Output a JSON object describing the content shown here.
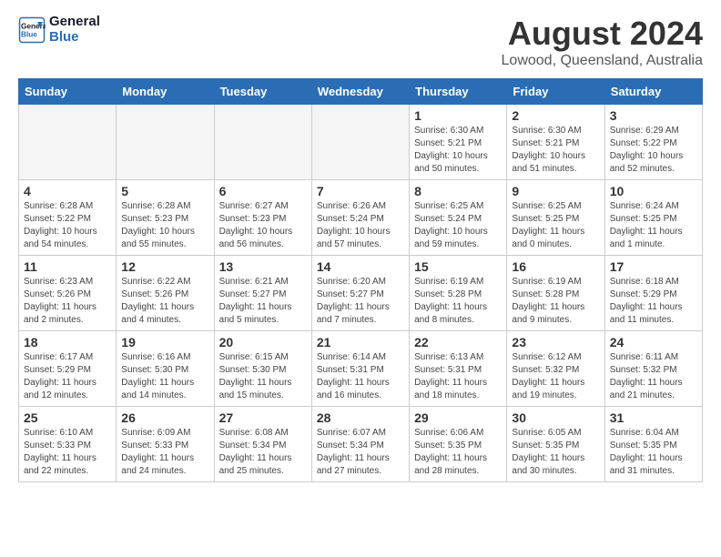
{
  "header": {
    "logo_line1": "General",
    "logo_line2": "Blue",
    "month_title": "August 2024",
    "location": "Lowood, Queensland, Australia"
  },
  "days_of_week": [
    "Sunday",
    "Monday",
    "Tuesday",
    "Wednesday",
    "Thursday",
    "Friday",
    "Saturday"
  ],
  "weeks": [
    [
      {
        "day": "",
        "info": "",
        "empty": true
      },
      {
        "day": "",
        "info": "",
        "empty": true
      },
      {
        "day": "",
        "info": "",
        "empty": true
      },
      {
        "day": "",
        "info": "",
        "empty": true
      },
      {
        "day": "1",
        "info": "Sunrise: 6:30 AM\nSunset: 5:21 PM\nDaylight: 10 hours\nand 50 minutes."
      },
      {
        "day": "2",
        "info": "Sunrise: 6:30 AM\nSunset: 5:21 PM\nDaylight: 10 hours\nand 51 minutes."
      },
      {
        "day": "3",
        "info": "Sunrise: 6:29 AM\nSunset: 5:22 PM\nDaylight: 10 hours\nand 52 minutes."
      }
    ],
    [
      {
        "day": "4",
        "info": "Sunrise: 6:28 AM\nSunset: 5:22 PM\nDaylight: 10 hours\nand 54 minutes."
      },
      {
        "day": "5",
        "info": "Sunrise: 6:28 AM\nSunset: 5:23 PM\nDaylight: 10 hours\nand 55 minutes."
      },
      {
        "day": "6",
        "info": "Sunrise: 6:27 AM\nSunset: 5:23 PM\nDaylight: 10 hours\nand 56 minutes."
      },
      {
        "day": "7",
        "info": "Sunrise: 6:26 AM\nSunset: 5:24 PM\nDaylight: 10 hours\nand 57 minutes."
      },
      {
        "day": "8",
        "info": "Sunrise: 6:25 AM\nSunset: 5:24 PM\nDaylight: 10 hours\nand 59 minutes."
      },
      {
        "day": "9",
        "info": "Sunrise: 6:25 AM\nSunset: 5:25 PM\nDaylight: 11 hours\nand 0 minutes."
      },
      {
        "day": "10",
        "info": "Sunrise: 6:24 AM\nSunset: 5:25 PM\nDaylight: 11 hours\nand 1 minute."
      }
    ],
    [
      {
        "day": "11",
        "info": "Sunrise: 6:23 AM\nSunset: 5:26 PM\nDaylight: 11 hours\nand 2 minutes."
      },
      {
        "day": "12",
        "info": "Sunrise: 6:22 AM\nSunset: 5:26 PM\nDaylight: 11 hours\nand 4 minutes."
      },
      {
        "day": "13",
        "info": "Sunrise: 6:21 AM\nSunset: 5:27 PM\nDaylight: 11 hours\nand 5 minutes."
      },
      {
        "day": "14",
        "info": "Sunrise: 6:20 AM\nSunset: 5:27 PM\nDaylight: 11 hours\nand 7 minutes."
      },
      {
        "day": "15",
        "info": "Sunrise: 6:19 AM\nSunset: 5:28 PM\nDaylight: 11 hours\nand 8 minutes."
      },
      {
        "day": "16",
        "info": "Sunrise: 6:19 AM\nSunset: 5:28 PM\nDaylight: 11 hours\nand 9 minutes."
      },
      {
        "day": "17",
        "info": "Sunrise: 6:18 AM\nSunset: 5:29 PM\nDaylight: 11 hours\nand 11 minutes."
      }
    ],
    [
      {
        "day": "18",
        "info": "Sunrise: 6:17 AM\nSunset: 5:29 PM\nDaylight: 11 hours\nand 12 minutes."
      },
      {
        "day": "19",
        "info": "Sunrise: 6:16 AM\nSunset: 5:30 PM\nDaylight: 11 hours\nand 14 minutes."
      },
      {
        "day": "20",
        "info": "Sunrise: 6:15 AM\nSunset: 5:30 PM\nDaylight: 11 hours\nand 15 minutes."
      },
      {
        "day": "21",
        "info": "Sunrise: 6:14 AM\nSunset: 5:31 PM\nDaylight: 11 hours\nand 16 minutes."
      },
      {
        "day": "22",
        "info": "Sunrise: 6:13 AM\nSunset: 5:31 PM\nDaylight: 11 hours\nand 18 minutes."
      },
      {
        "day": "23",
        "info": "Sunrise: 6:12 AM\nSunset: 5:32 PM\nDaylight: 11 hours\nand 19 minutes."
      },
      {
        "day": "24",
        "info": "Sunrise: 6:11 AM\nSunset: 5:32 PM\nDaylight: 11 hours\nand 21 minutes."
      }
    ],
    [
      {
        "day": "25",
        "info": "Sunrise: 6:10 AM\nSunset: 5:33 PM\nDaylight: 11 hours\nand 22 minutes."
      },
      {
        "day": "26",
        "info": "Sunrise: 6:09 AM\nSunset: 5:33 PM\nDaylight: 11 hours\nand 24 minutes."
      },
      {
        "day": "27",
        "info": "Sunrise: 6:08 AM\nSunset: 5:34 PM\nDaylight: 11 hours\nand 25 minutes."
      },
      {
        "day": "28",
        "info": "Sunrise: 6:07 AM\nSunset: 5:34 PM\nDaylight: 11 hours\nand 27 minutes."
      },
      {
        "day": "29",
        "info": "Sunrise: 6:06 AM\nSunset: 5:35 PM\nDaylight: 11 hours\nand 28 minutes."
      },
      {
        "day": "30",
        "info": "Sunrise: 6:05 AM\nSunset: 5:35 PM\nDaylight: 11 hours\nand 30 minutes."
      },
      {
        "day": "31",
        "info": "Sunrise: 6:04 AM\nSunset: 5:35 PM\nDaylight: 11 hours\nand 31 minutes."
      }
    ]
  ]
}
